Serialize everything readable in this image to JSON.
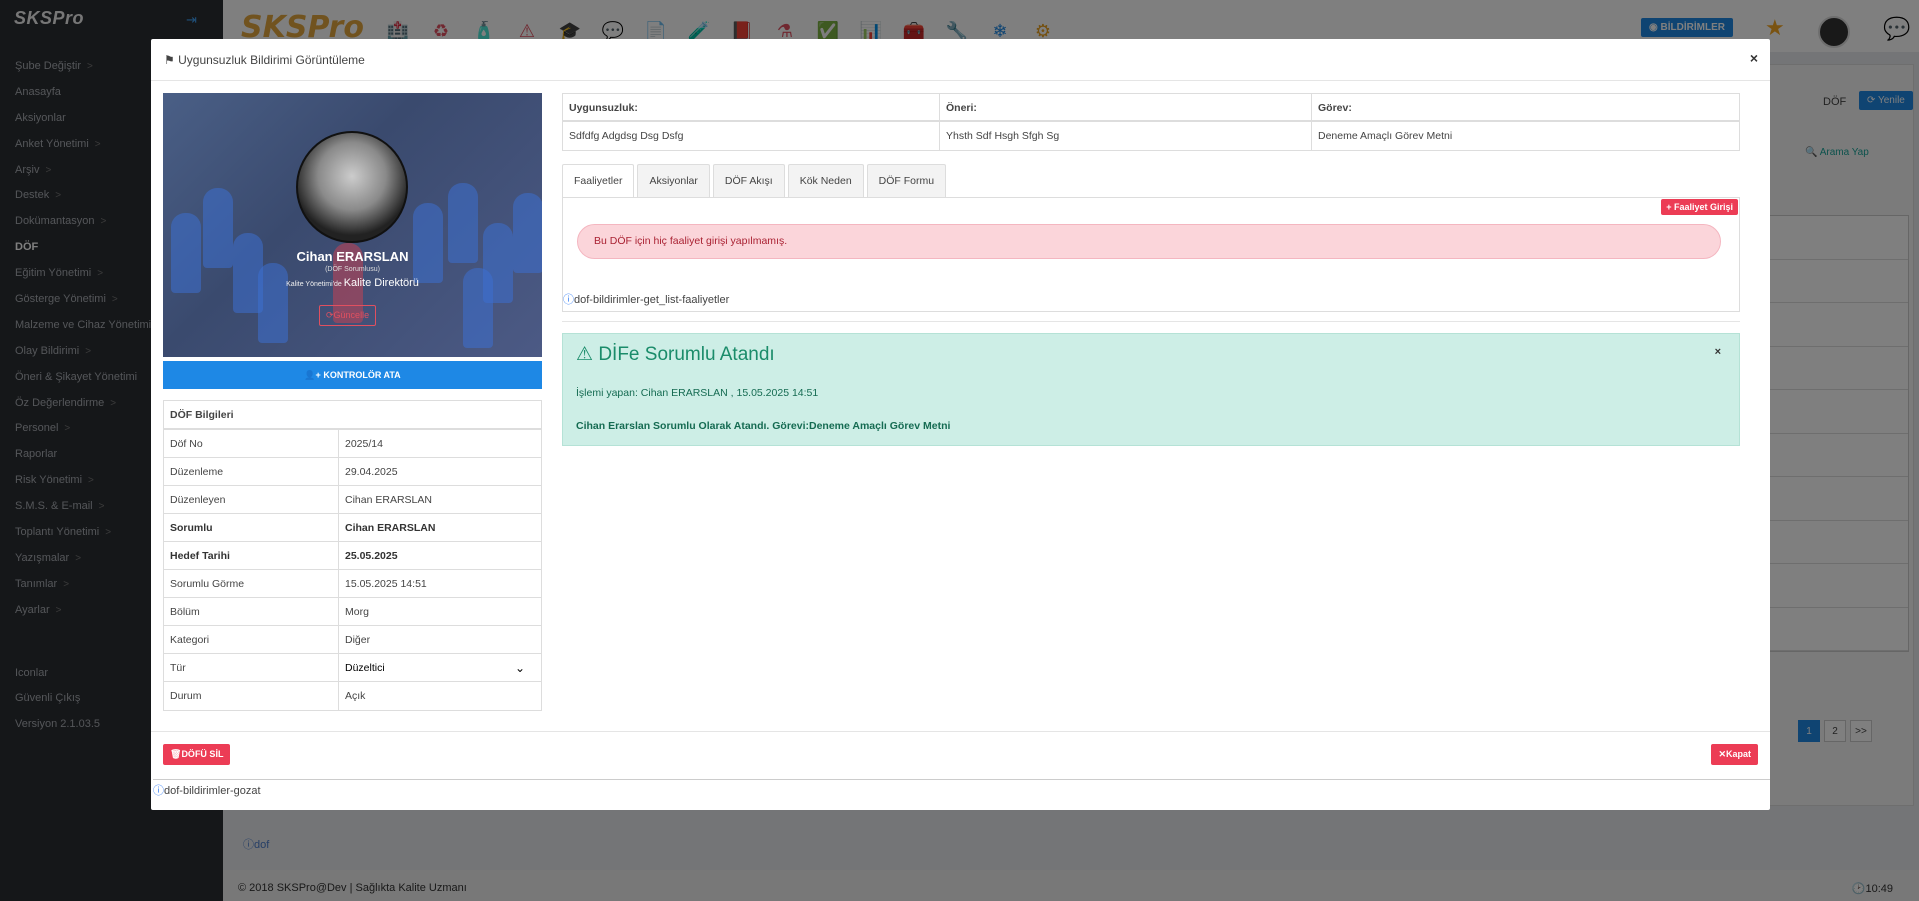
{
  "app": {
    "logo": "SKSPro",
    "brand": "SKSPro"
  },
  "sidebar": {
    "collapse_icon": "arrow-right-icon",
    "items": [
      {
        "label": "Şube Değiştir",
        "chevron": ">"
      },
      {
        "label": "Anasayfa",
        "chevron": ""
      },
      {
        "label": "Aksiyonlar",
        "chevron": ""
      },
      {
        "label": "Anket Yönetimi",
        "chevron": ">"
      },
      {
        "label": "Arşiv",
        "chevron": ">"
      },
      {
        "label": "Destek",
        "chevron": ">"
      },
      {
        "label": "Dokümantasyon",
        "chevron": ">"
      },
      {
        "label": "DÖF",
        "chevron": ""
      },
      {
        "label": "Eğitim Yönetimi",
        "chevron": ">"
      },
      {
        "label": "Gösterge Yönetimi",
        "chevron": ">"
      },
      {
        "label": "Malzeme ve Cihaz Yönetimi",
        "chevron": ""
      },
      {
        "label": "Olay Bildirimi",
        "chevron": ">"
      },
      {
        "label": "Öneri & Şikayet Yönetimi",
        "chevron": ""
      },
      {
        "label": "Öz Değerlendirme",
        "chevron": ">"
      },
      {
        "label": "Personel",
        "chevron": ">"
      },
      {
        "label": "Raporlar",
        "chevron": ""
      },
      {
        "label": "Risk Yönetimi",
        "chevron": ">"
      },
      {
        "label": "S.M.S. & E-mail",
        "chevron": ">"
      },
      {
        "label": "Toplantı Yönetimi",
        "chevron": ">"
      },
      {
        "label": "Yazışmalar",
        "chevron": ">"
      },
      {
        "label": "Tanımlar",
        "chevron": ">"
      },
      {
        "label": "Ayarlar",
        "chevron": ">"
      }
    ],
    "bottom_items": [
      {
        "label": "Iconlar"
      },
      {
        "label": "Güvenli Çıkış"
      },
      {
        "label": "Versiyon 2.1.03.5"
      }
    ]
  },
  "topbar": {
    "icons": [
      "hospital-icon",
      "recycle-icon",
      "bottle-icon",
      "warning-icon",
      "graduation-icon",
      "chat-bubbles-icon",
      "document-icon",
      "pipette-icon",
      "book-icon",
      "flask-icon",
      "clipboard-check-icon",
      "calendar-chart-icon",
      "toolbox-icon",
      "wrench-icon",
      "snowflake-icon",
      "gear-icon"
    ],
    "icon_glyphs": [
      "🏥",
      "♻",
      "🧴",
      "⚠",
      "🎓",
      "💬",
      "📄",
      "🧪",
      "📕",
      "⚗",
      "✅",
      "📊",
      "🧰",
      "🔧",
      "❄",
      "⚙"
    ],
    "icon_colors": [
      "#e05060",
      "#e05060",
      "#e05060",
      "#e05060",
      "#e05060",
      "#e05060",
      "#e05060",
      "#e05060",
      "#e05060",
      "#e05060",
      "#e05060",
      "#d63040",
      "#e05060",
      "#d62020",
      "#1e88e5",
      "#e8a020"
    ],
    "bildirimler_label": "BİLDİRİMLER",
    "star_icon": "star-icon",
    "chat_icon": "chat-icon"
  },
  "background": {
    "dof_label": "DÖF",
    "yenile_label": "Yenile",
    "arama_label": "Arama Yap",
    "pager": [
      "1",
      "2",
      ">>"
    ],
    "bottom_ref": "dof",
    "footer_left": "© 2018 SKSPro@Dev | Sağlıkta Kalite Uzmanı",
    "footer_time": "10:49"
  },
  "modal": {
    "title": "Uygunsuzluk Bildirimi Görüntüleme",
    "close": "×",
    "profile": {
      "name": "Cihan ERARSLAN",
      "role": "(DÖF Sorumlusu)",
      "dept_prefix": "Kalite Yönetimi'de",
      "dept_title": "Kalite Direktörü",
      "update_label": "Güncelle"
    },
    "kontrolor_label": "KONTROLÖR ATA",
    "info": {
      "heading": "DÖF Bilgileri",
      "rows": [
        {
          "k": "Döf No",
          "v": "2025/14"
        },
        {
          "k": "Düzenleme",
          "v": "29.04.2025"
        },
        {
          "k": "Düzenleyen",
          "v": "Cihan ERARSLAN"
        },
        {
          "k": "Sorumlu",
          "v": "Cihan ERARSLAN"
        },
        {
          "k": "Hedef Tarihi",
          "v": "25.05.2025"
        },
        {
          "k": "Sorumlu Görme",
          "v": "15.05.2025 14:51"
        },
        {
          "k": "Bölüm",
          "v": "Morg"
        },
        {
          "k": "Kategori",
          "v": "Diğer"
        },
        {
          "k": "Tür",
          "v": "Düzeltici"
        },
        {
          "k": "Durum",
          "v": "Açık"
        }
      ]
    },
    "summary": {
      "headers": [
        "Uygunsuzluk:",
        "Öneri:",
        "Görev:"
      ],
      "values": [
        "Sdfdfg Adgdsg Dsg Dsfg",
        "Yhsth Sdf Hsgh Sfgh Sg",
        "Deneme Amaçlı Görev Metni"
      ]
    },
    "tabs": [
      "Faaliyetler",
      "Aksiyonlar",
      "DÖF Akışı",
      "Kök Neden",
      "DÖF Formu"
    ],
    "faaliyet_button": "Faaliyet Girişi",
    "empty_message": "Bu DÖF için hiç faaliyet girişi yapılmamış.",
    "tab_ref": "dof-bildirimler-get_list-faaliyetler",
    "alert": {
      "title": "DİFe Sorumlu Atandı",
      "line1": "İşlemi yapan: Cihan ERARSLAN , 15.05.2025 14:51",
      "line2": "Cihan Erarslan Sorumlu Olarak Atandı. Görevi:Deneme Amaçlı Görev Metni",
      "close": "×"
    },
    "delete_label": "DÖFÜ SİL",
    "kapat_label": "Kapat",
    "footer_ref": "dof-bildirimler-gozat"
  },
  "colors": {
    "accent": "#1e88e5",
    "danger": "#ec3c55",
    "success_bg": "#cdeee6",
    "sidebar": "#2b2e33"
  }
}
